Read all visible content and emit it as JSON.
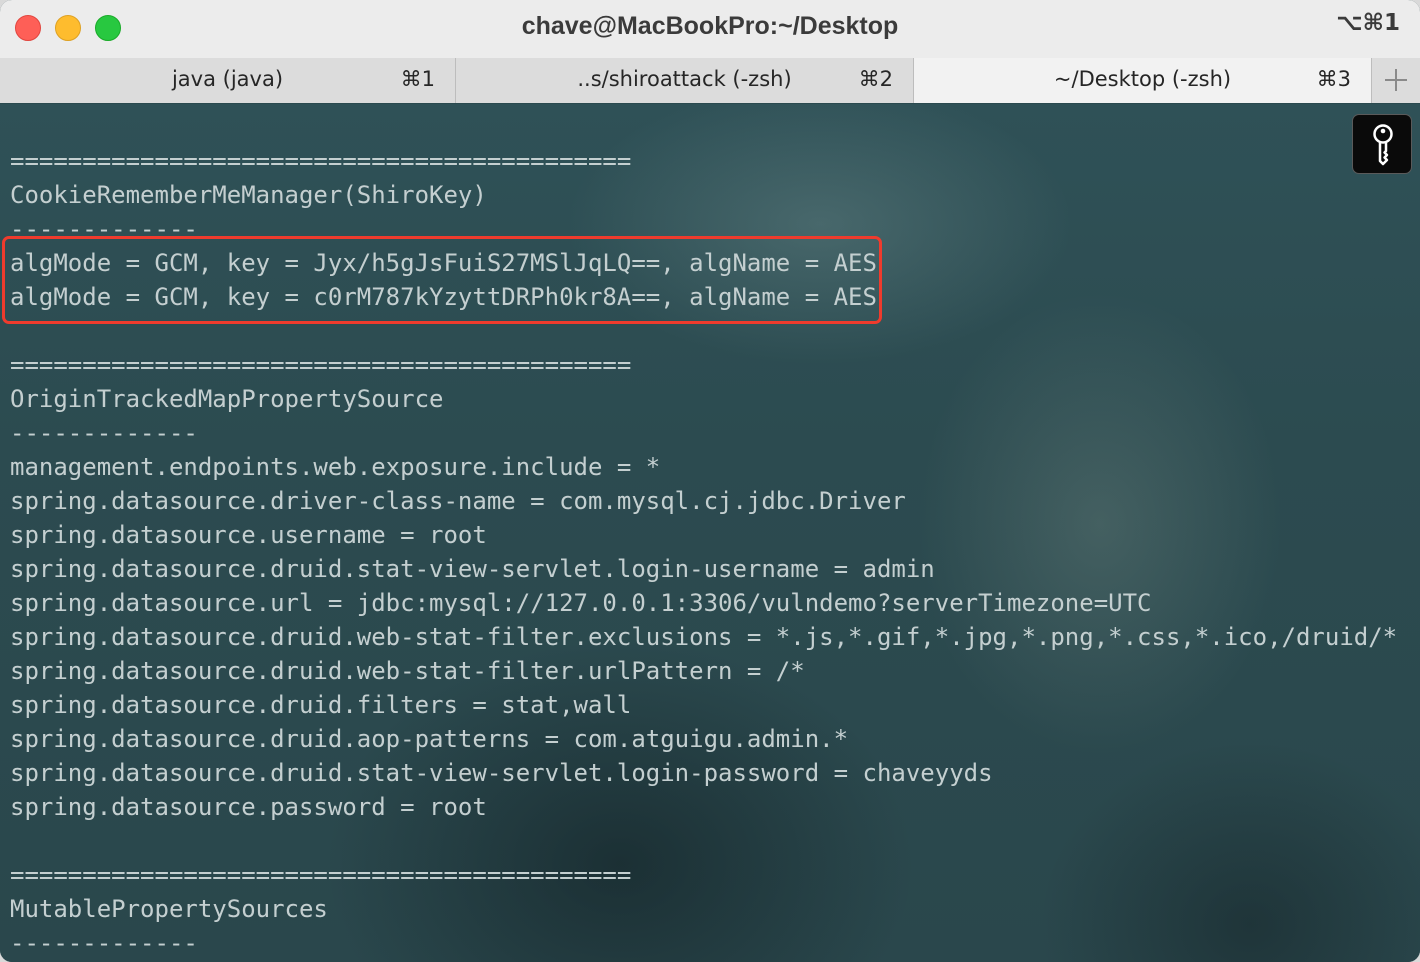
{
  "window": {
    "title": "chave@MacBookPro:~/Desktop",
    "title_shortcut": "⌥⌘1"
  },
  "tabs": [
    {
      "label": "java (java)",
      "shortcut": "⌘1",
      "active": false
    },
    {
      "label": "..s/shiroattack (-zsh)",
      "shortcut": "⌘2",
      "active": false
    },
    {
      "label": "~/Desktop (-zsh)",
      "shortcut": "⌘3",
      "active": true
    }
  ],
  "icons": {
    "new_tab": "plus-icon",
    "password_manager": "key-icon"
  },
  "colors": {
    "highlight_box": "#ef3b2d",
    "terminal_text": "#c4cfd0"
  },
  "terminal": {
    "lines": [
      "===========================================",
      "CookieRememberMeManager(ShiroKey)",
      "-------------",
      "algMode = GCM, key = Jyx/h5gJsFuiS27MSlJqLQ==, algName = AES",
      "algMode = GCM, key = c0rM787kYzyttDRPh0kr8A==, algName = AES",
      "",
      "===========================================",
      "OriginTrackedMapPropertySource",
      "-------------",
      "management.endpoints.web.exposure.include = *",
      "spring.datasource.driver-class-name = com.mysql.cj.jdbc.Driver",
      "spring.datasource.username = root",
      "spring.datasource.druid.stat-view-servlet.login-username = admin",
      "spring.datasource.url = jdbc:mysql://127.0.0.1:3306/vulndemo?serverTimezone=UTC",
      "spring.datasource.druid.web-stat-filter.exclusions = *.js,*.gif,*.jpg,*.png,*.css,*.ico,/druid/*",
      "spring.datasource.druid.web-stat-filter.urlPattern = /*",
      "spring.datasource.druid.filters = stat,wall",
      "spring.datasource.druid.aop-patterns = com.atguigu.admin.*",
      "spring.datasource.druid.stat-view-servlet.login-password = chaveyyds",
      "spring.datasource.password = root",
      "",
      "===========================================",
      "MutablePropertySources",
      "-------------"
    ]
  }
}
